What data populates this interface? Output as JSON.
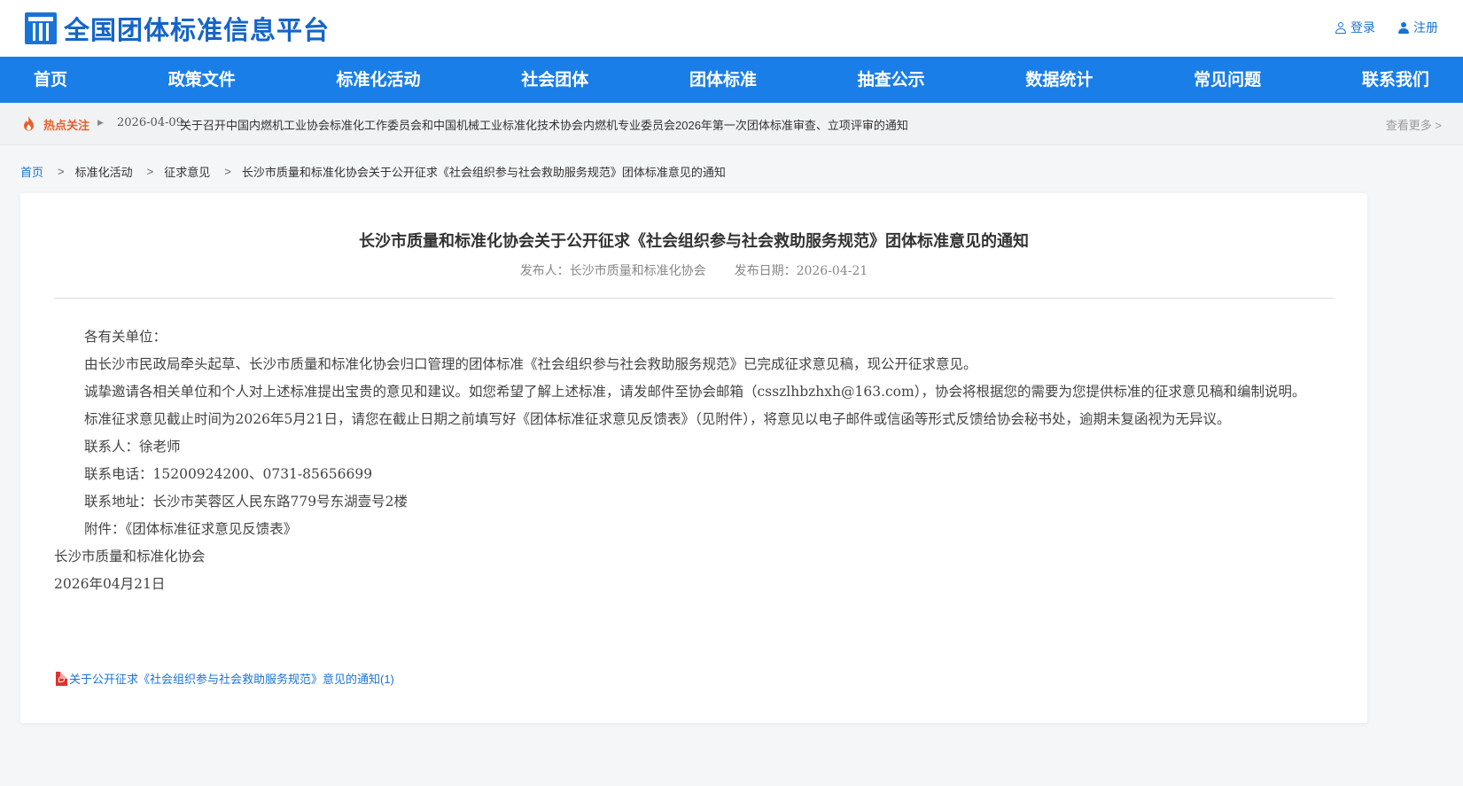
{
  "header": {
    "site_title": "全国团体标准信息平台",
    "login_label": "登录",
    "register_label": "注册"
  },
  "nav": {
    "items": [
      "首页",
      "政策文件",
      "标准化活动",
      "社会团体",
      "团体标准",
      "抽查公示",
      "数据统计",
      "常见问题",
      "联系我们"
    ]
  },
  "hotbar": {
    "label": "热点关注",
    "date": "2026-04-09",
    "title": "关于召开中国内燃机工业协会标准化工作委员会和中国机械工业标准化技术协会内燃机专业委员会2026年第一次团体标准审查、立项评审的通知",
    "more_label": "查看更多 >"
  },
  "breadcrumb": {
    "home": "首页",
    "items": [
      "标准化活动",
      "征求意见",
      "长沙市质量和标准化协会关于公开征求《社会组织参与社会救助服务规范》团体标准意见的通知"
    ],
    "separator": ">"
  },
  "article": {
    "title": "长沙市质量和标准化协会关于公开征求《社会组织参与社会救助服务规范》团体标准意见的通知",
    "publisher": "发布人：长沙市质量和标准化协会",
    "publish_date": "发布日期：2026-04-21",
    "paragraphs": [
      "各有关单位：",
      "由长沙市民政局牵头起草、长沙市质量和标准化协会归口管理的团体标准《社会组织参与社会救助服务规范》已完成征求意见稿，现公开征求意见。",
      "诚挚邀请各相关单位和个人对上述标准提出宝贵的意见和建议。如您希望了解上述标准，请发邮件至协会邮箱（csszlhbzhxh@163.com），协会将根据您的需要为您提供标准的征求意见稿和编制说明。",
      "标准征求意见截止时间为2026年5月21日，请您在截止日期之前填写好《团体标准征求意见反馈表》（见附件），将意见以电子邮件或信函等形式反馈给协会秘书处，逾期未复函视为无异议。",
      "联系人：徐老师",
      "联系电话：15200924200、0731-85656699",
      "联系地址：长沙市芙蓉区人民东路779号东湖壹号2楼",
      "附件：《团体标准征求意见反馈表》"
    ],
    "signature_org": "长沙市质量和标准化协会",
    "signature_date": "2026年04月21日",
    "attachment": "关于公开征求《社会组织参与社会救助服务规范》意见的通知(1)"
  },
  "colors": {
    "brand_blue": "#1a7ee8",
    "link_blue": "#1a73d6",
    "hot_orange": "#e9602b",
    "pdf_red": "#e0322d"
  }
}
